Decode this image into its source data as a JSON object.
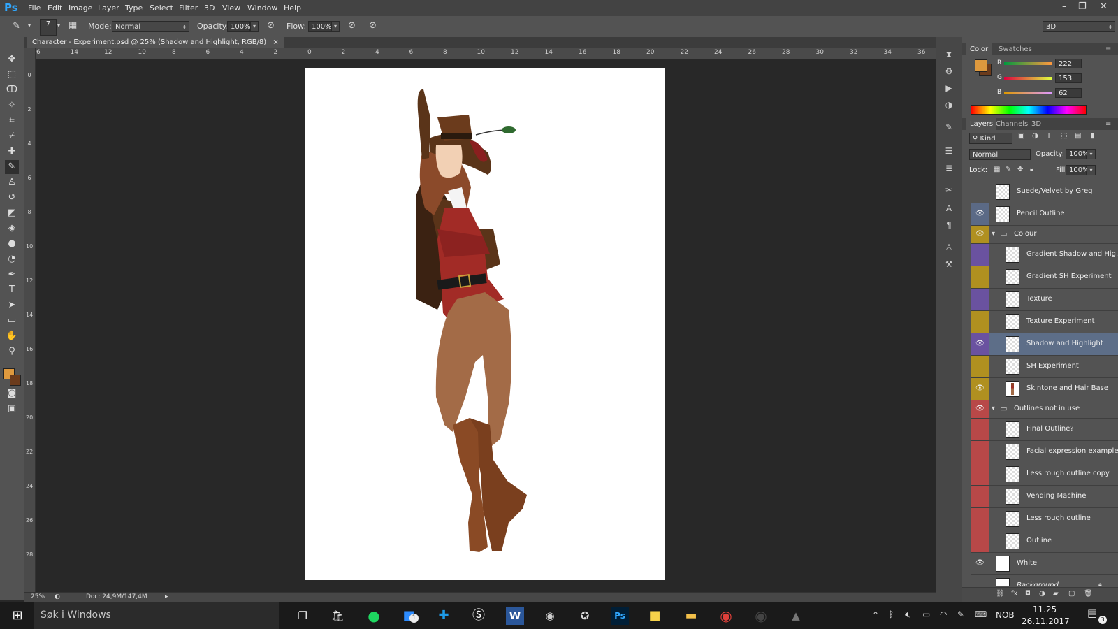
{
  "app": {
    "logo": "Ps"
  },
  "menu": [
    "File",
    "Edit",
    "Image",
    "Layer",
    "Type",
    "Select",
    "Filter",
    "3D",
    "View",
    "Window",
    "Help"
  ],
  "window_controls": {
    "minimize": "–",
    "restore": "❐",
    "close": "✕"
  },
  "options_bar": {
    "brush_size": "7",
    "mode_label": "Mode:",
    "mode_value": "Normal",
    "opacity_label": "Opacity:",
    "opacity_value": "100%",
    "flow_label": "Flow:",
    "flow_value": "100%",
    "workspace_value": "3D"
  },
  "document": {
    "tab_title": "Character - Experiment.psd @ 25% (Shadow and Highlight, RGB/8)",
    "tab_close": "×",
    "zoom": "25%",
    "doc_size": "Doc: 24,9M/147,4M"
  },
  "rulers": {
    "h": [
      "6",
      "14",
      "12",
      "10",
      "8",
      "6",
      "4",
      "2",
      "0",
      "2",
      "4",
      "6",
      "8",
      "10",
      "12",
      "14",
      "16",
      "18",
      "20",
      "22",
      "24",
      "26",
      "28",
      "30",
      "32",
      "34",
      "36"
    ],
    "v": [
      "0",
      "2",
      "4",
      "6",
      "8",
      "10",
      "12",
      "14",
      "16",
      "18",
      "20",
      "22",
      "24",
      "26",
      "28"
    ]
  },
  "color_panel": {
    "tabs": [
      "Color",
      "Swatches"
    ],
    "fg_color": "#de993e",
    "bg_color": "#6b3b1c",
    "r_label": "R",
    "g_label": "G",
    "b_label": "B",
    "r": "222",
    "g": "153",
    "b": "62"
  },
  "layers_panel": {
    "tabs": [
      "Layers",
      "Channels",
      "3D"
    ],
    "kind_label": "Kind",
    "blend_mode": "Normal",
    "opacity_label": "Opacity:",
    "opacity_value": "100%",
    "lock_label": "Lock:",
    "fill_label": "Fill:",
    "fill_value": "100%",
    "layers": [
      {
        "name": "Suede/Velvet by Greg",
        "visible": false,
        "color": "#535353",
        "indent": false
      },
      {
        "name": "Pencil Outline",
        "visible": true,
        "color": "#5b6a86",
        "indent": false
      },
      {
        "name": "Colour",
        "visible": true,
        "color": "#b09020",
        "group": true
      },
      {
        "name": "Gradient Shadow and Hig...",
        "visible": false,
        "color": "#6a52a0",
        "indent": true
      },
      {
        "name": "Gradient SH Experiment",
        "visible": false,
        "color": "#b09020",
        "indent": true
      },
      {
        "name": "Texture",
        "visible": false,
        "color": "#6a52a0",
        "indent": true
      },
      {
        "name": "Texture Experiment",
        "visible": false,
        "color": "#b09020",
        "indent": true
      },
      {
        "name": "Shadow and Highlight",
        "visible": true,
        "color": "#6a52a0",
        "indent": true,
        "selected": true
      },
      {
        "name": "SH Experiment",
        "visible": false,
        "color": "#b09020",
        "indent": true
      },
      {
        "name": "Skintone and Hair Base",
        "visible": true,
        "color": "#b09020",
        "indent": true,
        "thumb_figure": true
      },
      {
        "name": "Outlines not in use",
        "visible": true,
        "color": "#b84848",
        "group": true
      },
      {
        "name": "Final Outline?",
        "visible": false,
        "color": "#b84848",
        "indent": true
      },
      {
        "name": "Facial expression example",
        "visible": false,
        "color": "#b84848",
        "indent": true
      },
      {
        "name": "Less rough outline copy",
        "visible": false,
        "color": "#b84848",
        "indent": true
      },
      {
        "name": "Vending Machine",
        "visible": false,
        "color": "#b84848",
        "indent": true
      },
      {
        "name": "Less rough outline",
        "visible": false,
        "color": "#b84848",
        "indent": true
      },
      {
        "name": "Outline",
        "visible": false,
        "color": "#b84848",
        "indent": true
      },
      {
        "name": "White",
        "visible": true,
        "color": "#535353",
        "indent": false,
        "solid": true
      },
      {
        "name": "Background",
        "visible": false,
        "color": "#535353",
        "indent": false,
        "solid": true,
        "locked": true
      }
    ]
  },
  "taskbar": {
    "search_placeholder": "Søk i Windows",
    "language": "NOB",
    "time": "11.25",
    "date": "26.11.2017",
    "messenger_badge": "1",
    "notification_count": "3"
  }
}
